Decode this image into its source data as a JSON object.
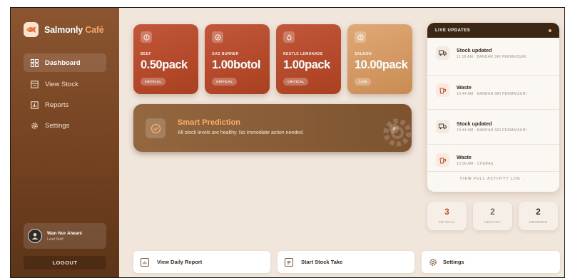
{
  "brand": {
    "name": "Salmonly",
    "accent": "Café"
  },
  "sidebar": {
    "items": [
      {
        "label": "Dashboard",
        "icon": "grid-icon",
        "active": true
      },
      {
        "label": "View Stock",
        "icon": "box-icon",
        "active": false
      },
      {
        "label": "Reports",
        "icon": "chart-icon",
        "active": false
      },
      {
        "label": "Settings",
        "icon": "gear-icon",
        "active": false
      }
    ],
    "profile": {
      "name": "Wan Nur Aiwani",
      "role": "Lead Staff"
    },
    "logout_label": "LOGOUT"
  },
  "stock_cards": [
    {
      "name": "BEEF",
      "value": "0.50pack",
      "status": "CRITICAL",
      "icon": "alert-icon",
      "color": "#b4482a"
    },
    {
      "name": "GAS BURNER",
      "value": "1.00botol",
      "status": "CRITICAL",
      "icon": "check-icon",
      "color": "#b4482a"
    },
    {
      "name": "NESTLE LEMONADE",
      "value": "1.00pack",
      "status": "CRITICAL",
      "icon": "drop-icon",
      "color": "#b4482a"
    },
    {
      "name": "SALMON",
      "value": "10.00pack",
      "status": "LOW",
      "icon": "alert-icon",
      "color": "#d49a62"
    }
  ],
  "prediction": {
    "title": "Smart Prediction",
    "text": "All stock levels are healthy. No immediate action needed.",
    "close": "×"
  },
  "live_updates": {
    "title": "LIVE UPDATES",
    "items": [
      {
        "title": "Stock updated",
        "meta": "11:18 AM · BANDAR SRI PERMAISURI",
        "icon": "truck-icon"
      },
      {
        "title": "Waste",
        "meta": "10:44 AM · BANDAR SRI PERMAISURI",
        "icon": "cup-icon"
      },
      {
        "title": "Stock updated",
        "meta": "10:44 AM · BANDAR SRI PERMAISURI",
        "icon": "truck-icon"
      },
      {
        "title": "Waste",
        "meta": "10:36 AM · CHERAS",
        "icon": "cup-icon"
      }
    ],
    "footer": "VIEW FULL ACTIVITY LOG →"
  },
  "stats": [
    {
      "value": "3",
      "label": "CRITICAL",
      "color": "#c0532c"
    },
    {
      "value": "2",
      "label": "HEALTHY",
      "color": "#6e6e55"
    },
    {
      "value": "2",
      "label": "REORDER",
      "color": "#3a2a1e"
    }
  ],
  "actions": [
    {
      "label": "View Daily Report",
      "icon": "report-icon"
    },
    {
      "label": "Start Stock Take",
      "icon": "clipboard-icon"
    },
    {
      "label": "Settings",
      "icon": "gear-icon"
    }
  ]
}
